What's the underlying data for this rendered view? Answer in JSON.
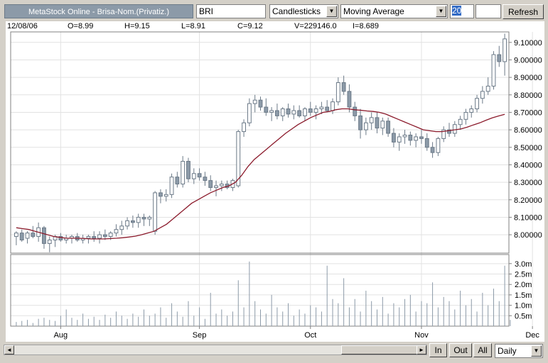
{
  "toolbar": {
    "title": "MetaStock Online - Brisa-Nom.(Privatiz.)",
    "symbol": "BRI",
    "chart_type": "Candlesticks",
    "indicator": "Moving Average",
    "period": "20",
    "refresh_label": "Refresh",
    "arrow_glyph": "▼"
  },
  "info": {
    "date": "12/08/06",
    "open": "O=8.99",
    "high": "H=9.15",
    "low": "L=8.91",
    "close": "C=9.12",
    "volume": "V=229146.0",
    "indicator_value": "I=8.689"
  },
  "chart_data": {
    "type": "candlestick",
    "price_axis_labels": [
      "9.10000",
      "9.00000",
      "8.90000",
      "8.80000",
      "8.70000",
      "8.60000",
      "8.50000",
      "8.40000",
      "8.30000",
      "8.20000",
      "8.10000",
      "8.00000"
    ],
    "price_axis_values": [
      9.1,
      9.0,
      8.9,
      8.8,
      8.7,
      8.6,
      8.5,
      8.4,
      8.3,
      8.2,
      8.1,
      8.0
    ],
    "volume_axis_labels": [
      "3.0m",
      "2.5m",
      "2.0m",
      "1.5m",
      "1.0m",
      "0.5m"
    ],
    "volume_axis_values": [
      3.0,
      2.5,
      2.0,
      1.5,
      1.0,
      0.5
    ],
    "x_labels": [
      "Aug",
      "Sep",
      "Oct",
      "Nov",
      "Dec"
    ],
    "x_label_index": [
      8,
      33,
      53,
      73,
      93
    ],
    "price_range": [
      7.895,
      9.16
    ],
    "volume_range": [
      0,
      3.3
    ],
    "candle_color_up": "#ffffff",
    "candle_color_down": "#8c9aa8",
    "moving_average_color": "#8b1a2b",
    "grid": true,
    "candles": [
      [
        7.99,
        8.02,
        7.94,
        8.01
      ],
      [
        8.01,
        8.03,
        7.96,
        7.97
      ],
      [
        7.98,
        8.02,
        7.95,
        8.01
      ],
      [
        8.01,
        8.05,
        7.98,
        7.99
      ],
      [
        7.99,
        8.07,
        7.96,
        8.04
      ],
      [
        8.04,
        8.05,
        7.92,
        7.95
      ],
      [
        7.95,
        7.99,
        7.9,
        7.97
      ],
      [
        7.97,
        8.0,
        7.93,
        7.99
      ],
      [
        7.99,
        8.01,
        7.96,
        7.97
      ],
      [
        7.97,
        8.0,
        7.95,
        7.98
      ],
      [
        7.98,
        8.0,
        7.95,
        7.99
      ],
      [
        7.99,
        8.01,
        7.96,
        7.97
      ],
      [
        7.97,
        8.0,
        7.95,
        7.98
      ],
      [
        7.98,
        8.0,
        7.95,
        7.99
      ],
      [
        7.99,
        8.02,
        7.96,
        7.98
      ],
      [
        7.98,
        8.02,
        7.95,
        8.0
      ],
      [
        8.0,
        8.03,
        7.97,
        7.99
      ],
      [
        7.99,
        8.02,
        7.97,
        8.01
      ],
      [
        8.01,
        8.06,
        7.99,
        8.03
      ],
      [
        8.03,
        8.08,
        8.0,
        8.05
      ],
      [
        8.05,
        8.1,
        8.03,
        8.08
      ],
      [
        8.08,
        8.11,
        8.04,
        8.07
      ],
      [
        8.07,
        8.12,
        8.04,
        8.1
      ],
      [
        8.1,
        8.12,
        8.05,
        8.09
      ],
      [
        8.09,
        8.11,
        8.05,
        8.1
      ],
      [
        8.02,
        8.25,
        8.0,
        8.24
      ],
      [
        8.24,
        8.26,
        8.18,
        8.22
      ],
      [
        8.22,
        8.26,
        8.19,
        8.23
      ],
      [
        8.23,
        8.35,
        8.21,
        8.33
      ],
      [
        8.33,
        8.36,
        8.27,
        8.29
      ],
      [
        8.29,
        8.45,
        8.27,
        8.42
      ],
      [
        8.42,
        8.44,
        8.3,
        8.32
      ],
      [
        8.32,
        8.38,
        8.29,
        8.35
      ],
      [
        8.35,
        8.38,
        8.31,
        8.33
      ],
      [
        8.33,
        8.36,
        8.28,
        8.31
      ],
      [
        8.31,
        8.34,
        8.25,
        8.27
      ],
      [
        8.27,
        8.31,
        8.22,
        8.28
      ],
      [
        8.28,
        8.31,
        8.25,
        8.29
      ],
      [
        8.29,
        8.31,
        8.26,
        8.27
      ],
      [
        8.27,
        8.32,
        8.25,
        8.31
      ],
      [
        8.28,
        8.6,
        8.27,
        8.59
      ],
      [
        8.59,
        8.66,
        8.56,
        8.64
      ],
      [
        8.64,
        8.78,
        8.62,
        8.75
      ],
      [
        8.75,
        8.8,
        8.7,
        8.77
      ],
      [
        8.77,
        8.79,
        8.71,
        8.73
      ],
      [
        8.73,
        8.78,
        8.68,
        8.7
      ],
      [
        8.7,
        8.73,
        8.65,
        8.71
      ],
      [
        8.71,
        8.75,
        8.66,
        8.68
      ],
      [
        8.68,
        8.73,
        8.65,
        8.72
      ],
      [
        8.72,
        8.75,
        8.67,
        8.69
      ],
      [
        8.69,
        8.74,
        8.66,
        8.71
      ],
      [
        8.71,
        8.74,
        8.67,
        8.68
      ],
      [
        8.68,
        8.73,
        8.65,
        8.72
      ],
      [
        8.72,
        8.76,
        8.68,
        8.7
      ],
      [
        8.7,
        8.74,
        8.66,
        8.72
      ],
      [
        8.72,
        8.76,
        8.69,
        8.73
      ],
      [
        8.73,
        8.77,
        8.7,
        8.71
      ],
      [
        8.71,
        8.78,
        8.69,
        8.76
      ],
      [
        8.76,
        8.9,
        8.74,
        8.87
      ],
      [
        8.87,
        8.91,
        8.8,
        8.82
      ],
      [
        8.82,
        8.86,
        8.7,
        8.73
      ],
      [
        8.73,
        8.76,
        8.65,
        8.68
      ],
      [
        8.68,
        8.72,
        8.55,
        8.6
      ],
      [
        8.6,
        8.67,
        8.57,
        8.64
      ],
      [
        8.64,
        8.7,
        8.6,
        8.67
      ],
      [
        8.67,
        8.7,
        8.58,
        8.61
      ],
      [
        8.61,
        8.67,
        8.57,
        8.65
      ],
      [
        8.65,
        8.67,
        8.56,
        8.58
      ],
      [
        8.58,
        8.61,
        8.5,
        8.53
      ],
      [
        8.53,
        8.58,
        8.48,
        8.56
      ],
      [
        8.56,
        8.6,
        8.52,
        8.57
      ],
      [
        8.57,
        8.59,
        8.51,
        8.54
      ],
      [
        8.54,
        8.58,
        8.5,
        8.56
      ],
      [
        8.56,
        8.6,
        8.52,
        8.55
      ],
      [
        8.55,
        8.58,
        8.48,
        8.5
      ],
      [
        8.5,
        8.53,
        8.44,
        8.47
      ],
      [
        8.47,
        8.56,
        8.45,
        8.55
      ],
      [
        8.55,
        8.62,
        8.53,
        8.6
      ],
      [
        8.6,
        8.64,
        8.56,
        8.58
      ],
      [
        8.58,
        8.65,
        8.56,
        8.63
      ],
      [
        8.63,
        8.68,
        8.6,
        8.66
      ],
      [
        8.66,
        8.72,
        8.63,
        8.7
      ],
      [
        8.7,
        8.74,
        8.67,
        8.72
      ],
      [
        8.72,
        8.8,
        8.7,
        8.78
      ],
      [
        8.78,
        8.85,
        8.75,
        8.82
      ],
      [
        8.82,
        8.9,
        8.8,
        8.85
      ],
      [
        8.85,
        9.05,
        8.83,
        9.03
      ],
      [
        9.03,
        9.08,
        8.96,
        8.99
      ],
      [
        8.99,
        9.15,
        8.91,
        9.12
      ]
    ],
    "moving_average": [
      8.04,
      8.035,
      8.03,
      8.02,
      8.01,
      8.0,
      7.99,
      7.985,
      7.98,
      7.98,
      7.98,
      7.978,
      7.976,
      7.976,
      7.976,
      7.978,
      7.98,
      7.983,
      7.987,
      7.992,
      8.0,
      8.01,
      8.02,
      8.04,
      8.06,
      8.09,
      8.12,
      8.15,
      8.18,
      8.2,
      8.22,
      8.24,
      8.255,
      8.27,
      8.28,
      8.3,
      8.34,
      8.39,
      8.43,
      8.46,
      8.49,
      8.52,
      8.55,
      8.58,
      8.605,
      8.63,
      8.65,
      8.67,
      8.685,
      8.7,
      8.705,
      8.715,
      8.72,
      8.72,
      8.715,
      8.712,
      8.708,
      8.705,
      8.7,
      8.69,
      8.675,
      8.66,
      8.645,
      8.63,
      8.615,
      8.6,
      8.595,
      8.59,
      8.59,
      8.595,
      8.6,
      8.605,
      8.615,
      8.628,
      8.64,
      8.655,
      8.668,
      8.679,
      8.689
    ],
    "volume": [
      0.2,
      0.25,
      0.3,
      0.15,
      0.35,
      0.4,
      0.3,
      0.25,
      0.5,
      0.8,
      0.4,
      0.3,
      0.6,
      0.35,
      0.45,
      0.3,
      0.55,
      0.4,
      0.7,
      0.5,
      0.35,
      0.6,
      0.45,
      0.8,
      0.5,
      0.6,
      0.9,
      0.4,
      1.1,
      0.7,
      0.45,
      1.2,
      0.5,
      0.9,
      0.35,
      1.6,
      0.6,
      0.8,
      0.5,
      0.7,
      2.2,
      0.9,
      3.1,
      1.2,
      0.8,
      0.6,
      1.5,
      0.9,
      0.7,
      1.1,
      0.5,
      0.8,
      0.6,
      1.0,
      0.9,
      0.7,
      2.9,
      1.3,
      1.1,
      2.3,
      0.9,
      1.3,
      0.7,
      1.7,
      1.2,
      0.8,
      1.4,
      0.6,
      1.1,
      0.9,
      1.3,
      1.5,
      0.7,
      1.2,
      1.1,
      2.1,
      0.9,
      1.4,
      1.2,
      0.8,
      1.7,
      1.0,
      1.3,
      0.7,
      1.6,
      1.0,
      1.8,
      1.2,
      2.9,
      0.3
    ]
  },
  "bottom": {
    "scroll_left": "◄",
    "scroll_right": "►",
    "zoom_in_label": "In",
    "zoom_out_label": "Out",
    "all_label": "All",
    "interval": "Daily",
    "arrow_glyph": "▼"
  }
}
